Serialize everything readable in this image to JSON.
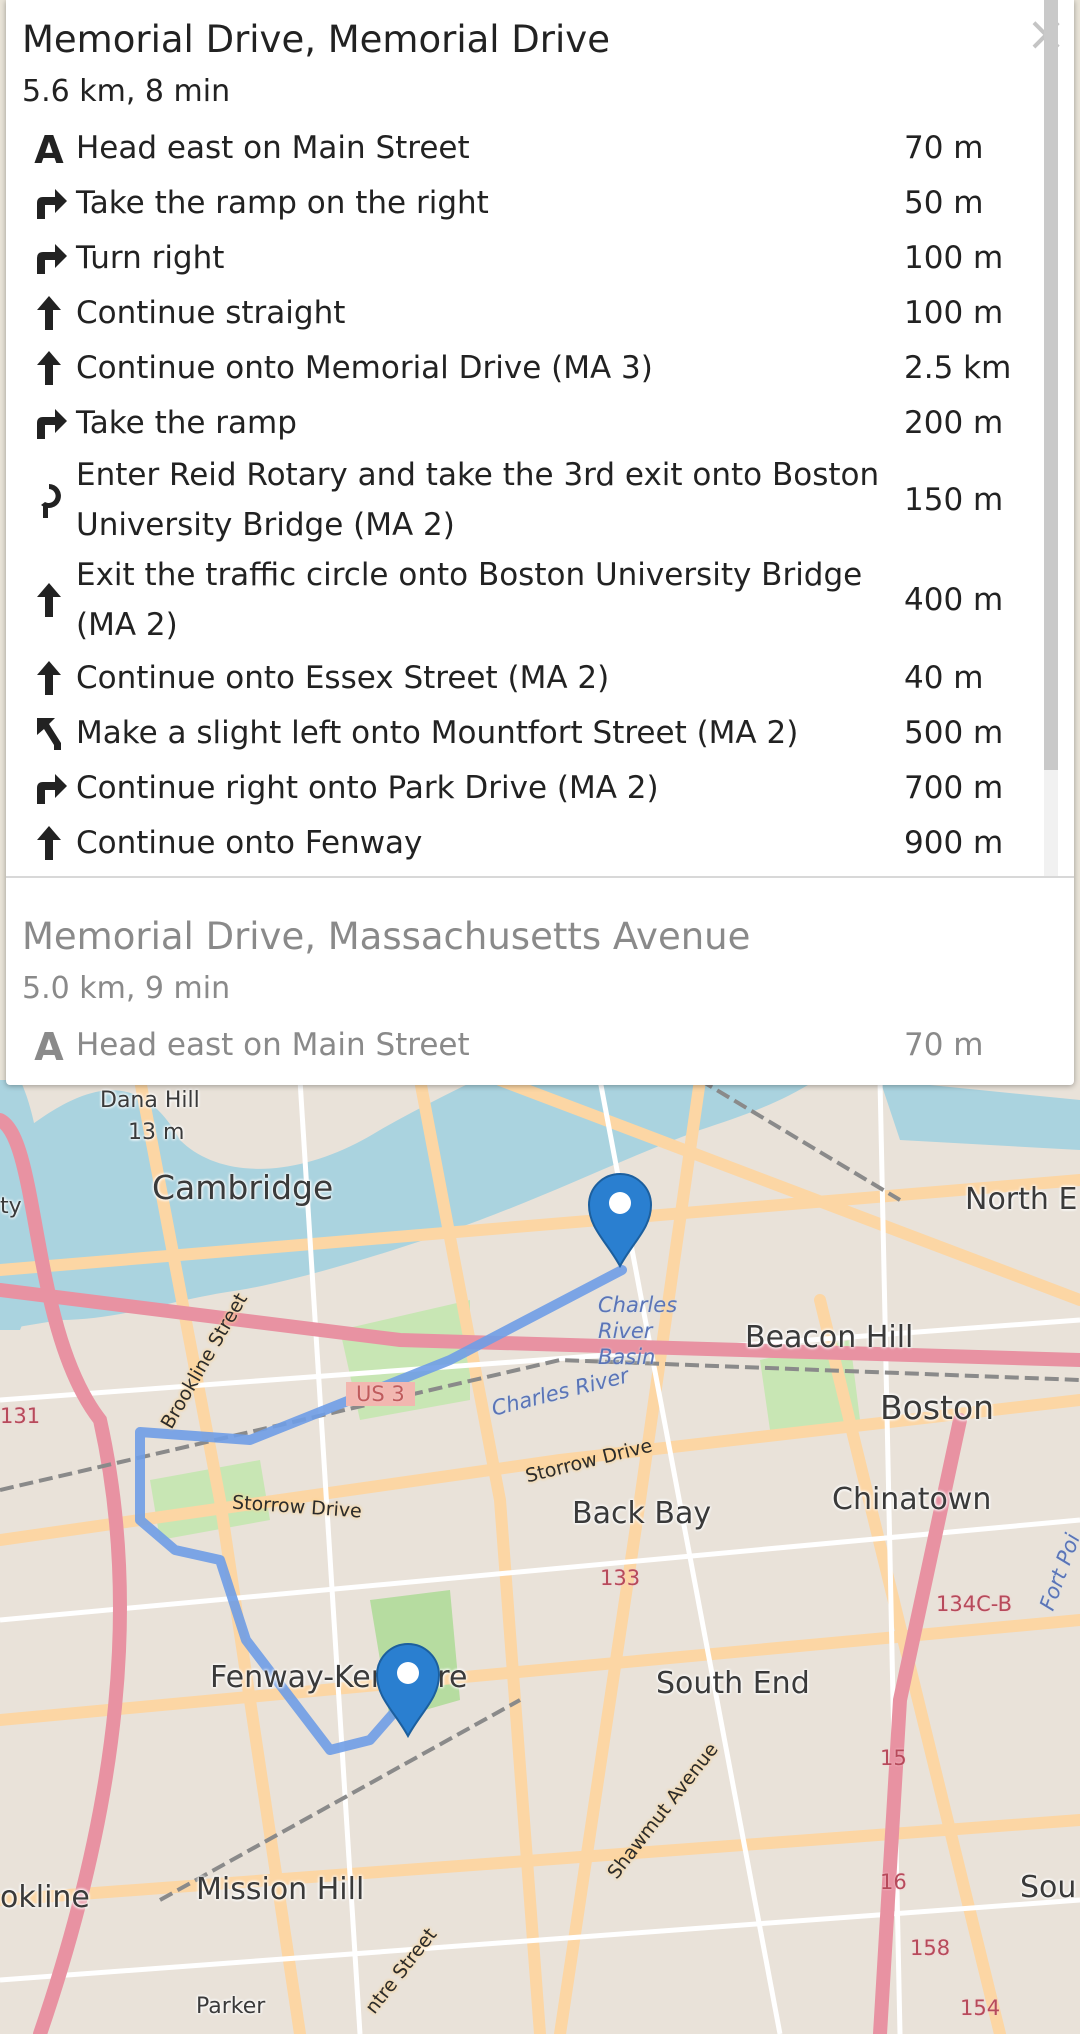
{
  "panel": {
    "close_label": "×",
    "routes": [
      {
        "title": "Memorial Drive, Memorial Drive",
        "summary": "5.6 km, 8 min",
        "steps": [
          {
            "icon": "depart-icon",
            "text": "Head east on Main Street",
            "distance": "70 m"
          },
          {
            "icon": "turn-right-icon",
            "text": "Take the ramp on the right",
            "distance": "50 m"
          },
          {
            "icon": "turn-right-icon",
            "text": "Turn right",
            "distance": "100 m"
          },
          {
            "icon": "straight-icon",
            "text": "Continue straight",
            "distance": "100 m"
          },
          {
            "icon": "straight-icon",
            "text": "Continue onto Memorial Drive (MA 3)",
            "distance": "2.5 km"
          },
          {
            "icon": "turn-right-icon",
            "text": "Take the ramp",
            "distance": "200 m"
          },
          {
            "icon": "roundabout-icon",
            "text": "Enter Reid Rotary and take the 3rd exit onto Boston University Bridge (MA 2)",
            "distance": "150 m"
          },
          {
            "icon": "straight-icon",
            "text": "Exit the traffic circle onto Boston University Bridge (MA 2)",
            "distance": "400 m"
          },
          {
            "icon": "straight-icon",
            "text": "Continue onto Essex Street (MA 2)",
            "distance": "40 m"
          },
          {
            "icon": "slight-left-icon",
            "text": "Make a slight left onto Mountfort Street (MA 2)",
            "distance": "500 m"
          },
          {
            "icon": "turn-right-icon",
            "text": "Continue right onto Park Drive (MA 2)",
            "distance": "700 m"
          },
          {
            "icon": "straight-icon",
            "text": "Continue onto Fenway",
            "distance": "900 m"
          }
        ]
      },
      {
        "title": "Memorial Drive, Massachusetts Avenue",
        "summary": "5.0 km, 9 min",
        "steps": [
          {
            "icon": "depart-icon",
            "text": "Head east on Main Street",
            "distance": "70 m"
          }
        ]
      }
    ]
  },
  "map": {
    "labels": {
      "dana_hill": "Dana Hill",
      "dana_hill_elev": "13 m",
      "cambridge": "Cambridge",
      "north_end": "North E",
      "beacon_hill": "Beacon Hill",
      "boston": "Boston",
      "chinatown": "Chinatown",
      "back_bay": "Back Bay",
      "south_end": "South End",
      "fenway": "Fenway-Kenmore",
      "mission_hill": "Mission Hill",
      "brookline": "okline",
      "parker": "Parker",
      "sou": "Sou",
      "charles_basin": "Charles River Basin",
      "charles_river": "Charles River",
      "storrow_1": "Storrow Drive",
      "storrow_2": "Storrow Drive",
      "brookline_st": "Brookline Street",
      "shawmut": "Shawmut Avenue",
      "us3": "US 3",
      "r131": "131",
      "r133": "133",
      "r134": "134C-B",
      "r15": "15",
      "r16": "16",
      "r158": "158",
      "r154": "154",
      "fort_point": "Fort Poi",
      "ty": "ty",
      "centre_st": "ntre Street"
    },
    "colors": {
      "route": "#6f9de6",
      "marker": "#2a7fd0",
      "water": "#aad3df",
      "major_road": "#fcd6a4",
      "motorway": "#e892a2"
    }
  }
}
